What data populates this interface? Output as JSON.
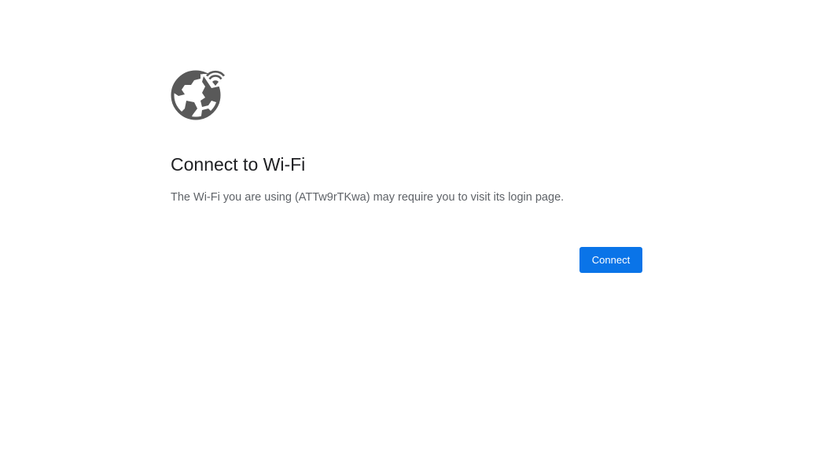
{
  "page": {
    "icon": "globe-wifi-icon",
    "title": "Connect to Wi-Fi",
    "description": "The Wi-Fi you are using (ATTw9rTKwa) may require you to visit its login page.",
    "connect_label": "Connect"
  },
  "colors": {
    "icon": "#595959",
    "title": "#202124",
    "text": "#5f6368",
    "button_bg": "#0a74e8",
    "button_text": "#ffffff",
    "background": "#ffffff"
  }
}
